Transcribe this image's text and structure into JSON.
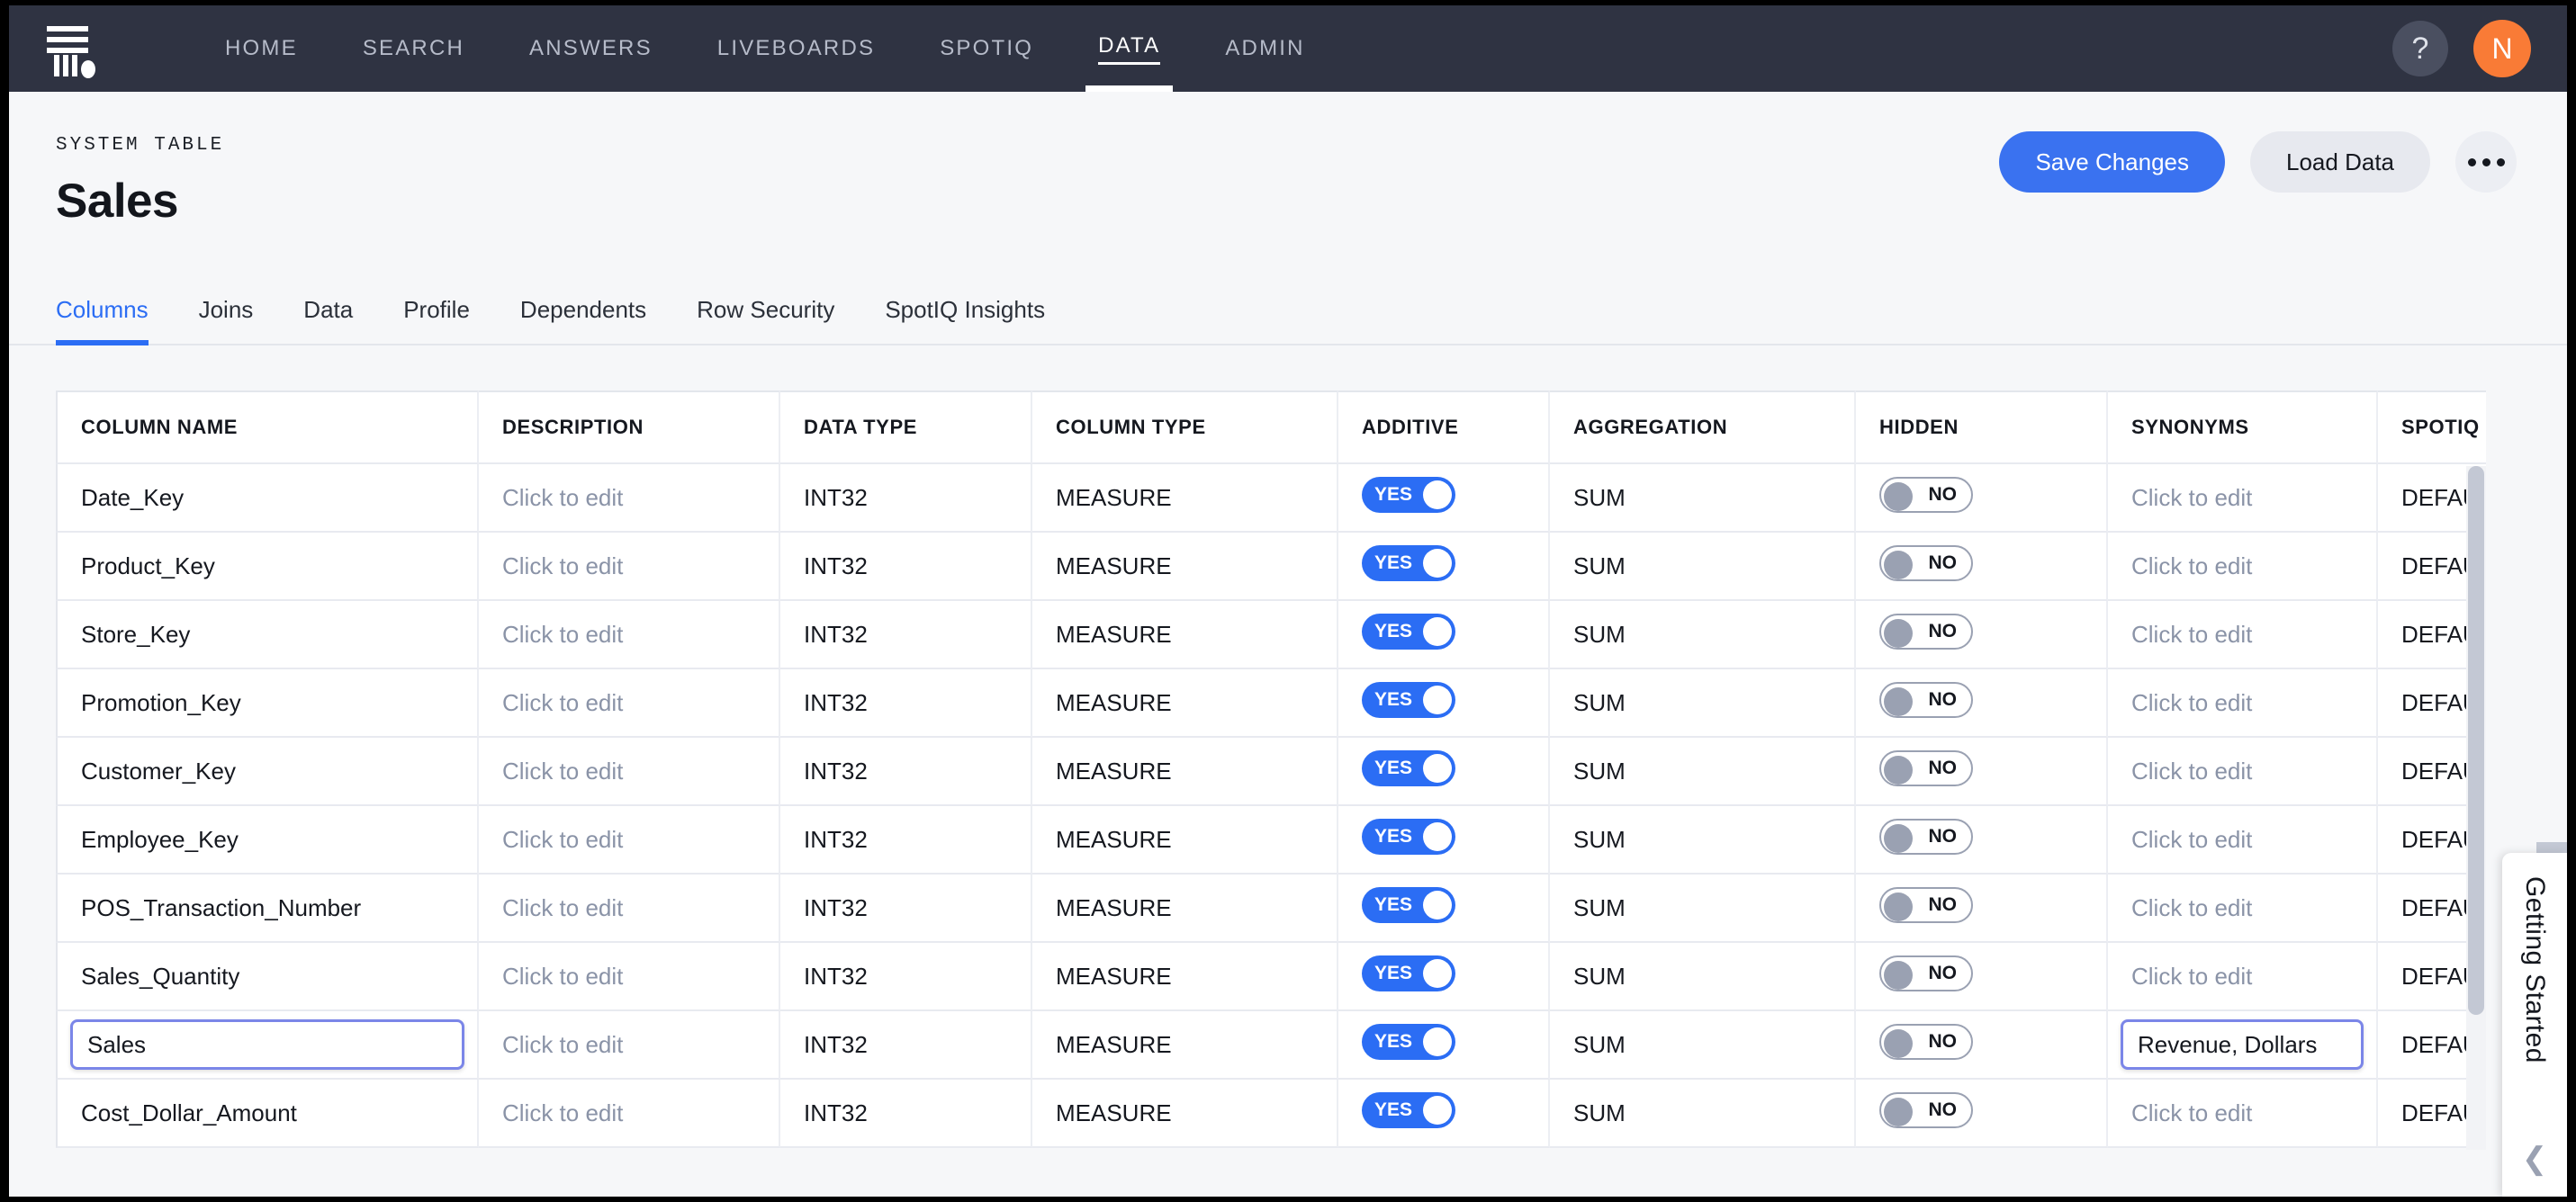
{
  "nav": {
    "logo_name": "thoughtspot-logo",
    "items": [
      {
        "label": "HOME",
        "active": false
      },
      {
        "label": "SEARCH",
        "active": false
      },
      {
        "label": "ANSWERS",
        "active": false
      },
      {
        "label": "LIVEBOARDS",
        "active": false
      },
      {
        "label": "SPOTIQ",
        "active": false
      },
      {
        "label": "DATA",
        "active": true
      },
      {
        "label": "ADMIN",
        "active": false
      }
    ],
    "help_label": "?",
    "avatar_label": "N",
    "avatar_color": "#f97b36",
    "bar_color": "#2f3342"
  },
  "header": {
    "eyebrow": "SYSTEM TABLE",
    "title": "Sales",
    "save_label": "Save Changes",
    "load_label": "Load Data",
    "accent_color": "#3a72f0"
  },
  "tabs": [
    {
      "label": "Columns",
      "active": true
    },
    {
      "label": "Joins",
      "active": false
    },
    {
      "label": "Data",
      "active": false
    },
    {
      "label": "Profile",
      "active": false
    },
    {
      "label": "Dependents",
      "active": false
    },
    {
      "label": "Row Security",
      "active": false
    },
    {
      "label": "SpotIQ Insights",
      "active": false
    }
  ],
  "table": {
    "headers": [
      "COLUMN NAME",
      "DESCRIPTION",
      "DATA TYPE",
      "COLUMN TYPE",
      "ADDITIVE",
      "AGGREGATION",
      "HIDDEN",
      "SYNONYMS",
      "SPOTIQ PR"
    ],
    "placeholder_edit": "Click to edit",
    "toggle_yes": "YES",
    "toggle_no": "NO",
    "rows": [
      {
        "name": "Date_Key",
        "description": "",
        "data_type": "INT32",
        "column_type": "MEASURE",
        "additive": "YES",
        "aggregation": "SUM",
        "hidden": "NO",
        "synonyms": "",
        "spotiq": "DEFAULT",
        "editing_name": false,
        "editing_synonyms": false
      },
      {
        "name": "Product_Key",
        "description": "",
        "data_type": "INT32",
        "column_type": "MEASURE",
        "additive": "YES",
        "aggregation": "SUM",
        "hidden": "NO",
        "synonyms": "",
        "spotiq": "DEFAULT",
        "editing_name": false,
        "editing_synonyms": false
      },
      {
        "name": "Store_Key",
        "description": "",
        "data_type": "INT32",
        "column_type": "MEASURE",
        "additive": "YES",
        "aggregation": "SUM",
        "hidden": "NO",
        "synonyms": "",
        "spotiq": "DEFAULT",
        "editing_name": false,
        "editing_synonyms": false
      },
      {
        "name": "Promotion_Key",
        "description": "",
        "data_type": "INT32",
        "column_type": "MEASURE",
        "additive": "YES",
        "aggregation": "SUM",
        "hidden": "NO",
        "synonyms": "",
        "spotiq": "DEFAULT",
        "editing_name": false,
        "editing_synonyms": false
      },
      {
        "name": "Customer_Key",
        "description": "",
        "data_type": "INT32",
        "column_type": "MEASURE",
        "additive": "YES",
        "aggregation": "SUM",
        "hidden": "NO",
        "synonyms": "",
        "spotiq": "DEFAULT",
        "editing_name": false,
        "editing_synonyms": false
      },
      {
        "name": "Employee_Key",
        "description": "",
        "data_type": "INT32",
        "column_type": "MEASURE",
        "additive": "YES",
        "aggregation": "SUM",
        "hidden": "NO",
        "synonyms": "",
        "spotiq": "DEFAULT",
        "editing_name": false,
        "editing_synonyms": false
      },
      {
        "name": "POS_Transaction_Number",
        "description": "",
        "data_type": "INT32",
        "column_type": "MEASURE",
        "additive": "YES",
        "aggregation": "SUM",
        "hidden": "NO",
        "synonyms": "",
        "spotiq": "DEFAULT",
        "editing_name": false,
        "editing_synonyms": false
      },
      {
        "name": "Sales_Quantity",
        "description": "",
        "data_type": "INT32",
        "column_type": "MEASURE",
        "additive": "YES",
        "aggregation": "SUM",
        "hidden": "NO",
        "synonyms": "",
        "spotiq": "DEFAULT",
        "editing_name": false,
        "editing_synonyms": false
      },
      {
        "name": "Sales",
        "description": "",
        "data_type": "INT32",
        "column_type": "MEASURE",
        "additive": "YES",
        "aggregation": "SUM",
        "hidden": "NO",
        "synonyms": "Revenue, Dollars",
        "spotiq": "DEFAULT",
        "editing_name": true,
        "editing_synonyms": true
      },
      {
        "name": "Cost_Dollar_Amount",
        "description": "",
        "data_type": "INT32",
        "column_type": "MEASURE",
        "additive": "YES",
        "aggregation": "SUM",
        "hidden": "NO",
        "synonyms": "",
        "spotiq": "DEFAULT",
        "editing_name": false,
        "editing_synonyms": false
      }
    ]
  },
  "side_panel": {
    "label": "Getting Started",
    "collapse_icon": "chevron-left-icon"
  }
}
